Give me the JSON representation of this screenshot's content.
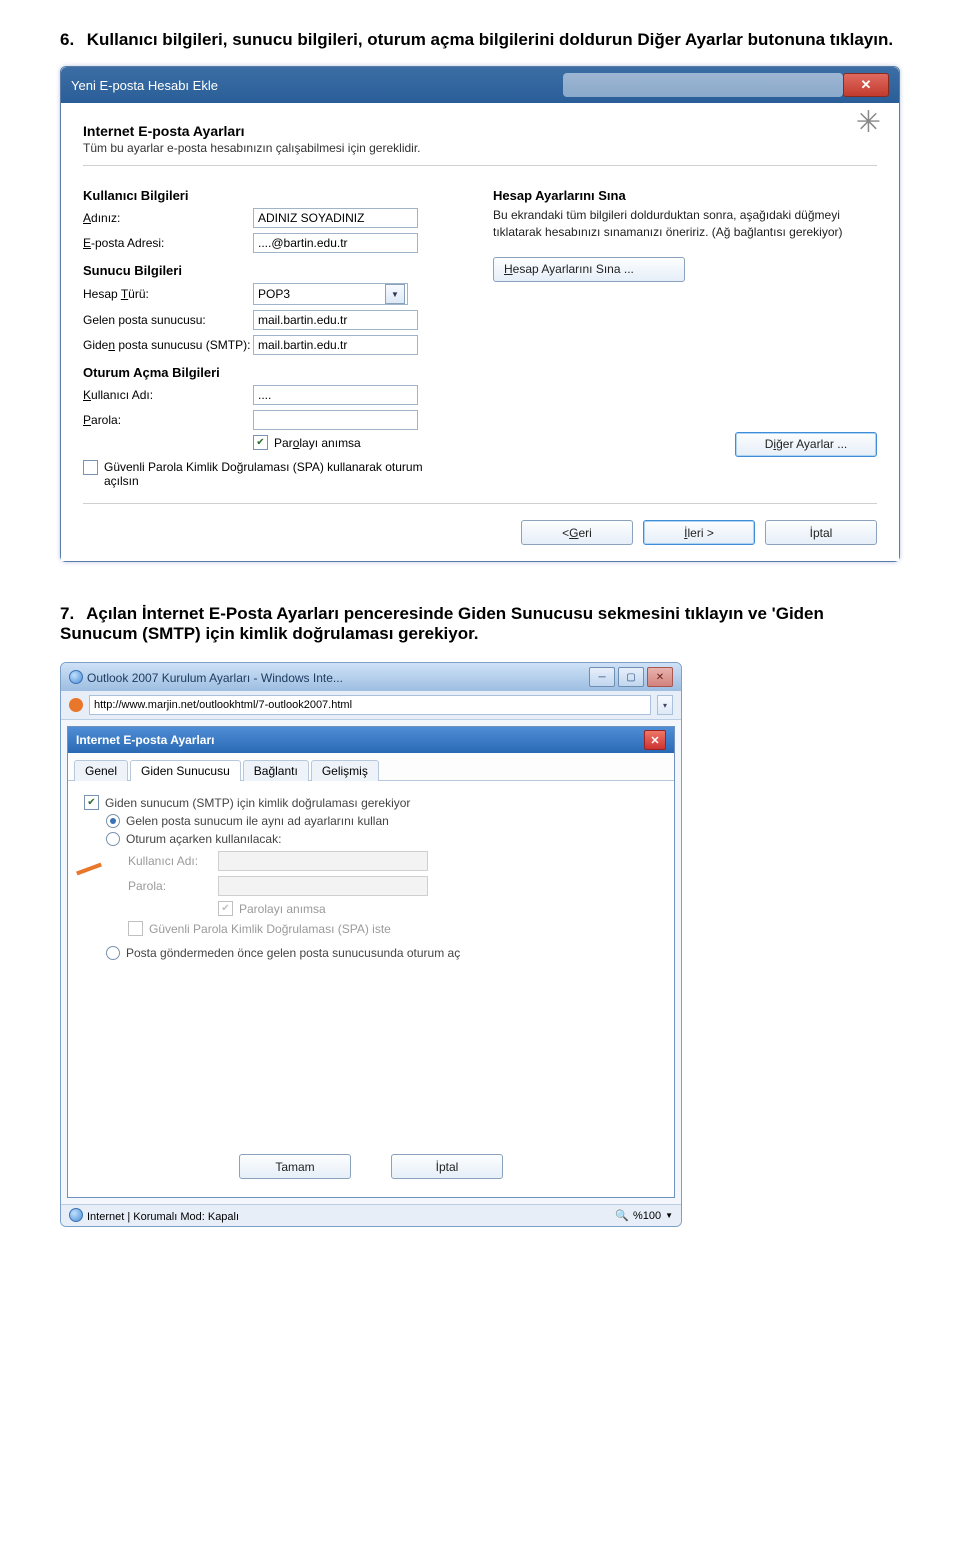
{
  "step6": {
    "num": "6.",
    "text": "Kullanıcı bilgileri, sunucu bilgileri, oturum açma bilgilerini doldurun Diğer Ayarlar butonuna tıklayın."
  },
  "win1": {
    "title": "Yeni E-posta Hesabı Ekle",
    "header_title": "Internet E-posta Ayarları",
    "header_sub": "Tüm bu ayarlar e-posta hesabınızın çalışabilmesi için gereklidir.",
    "left": {
      "user_heading": "Kullanıcı Bilgileri",
      "name_label_a": "A",
      "name_label_b": "dınız:",
      "name_val": "ADINIZ SOYADINIZ",
      "email_label_a": "E",
      "email_label_b": "-posta Adresi:",
      "email_val": "....@bartin.edu.tr",
      "server_heading": "Sunucu Bilgileri",
      "type_label_a": "Hesap ",
      "type_label_u": "T",
      "type_label_b": "ürü:",
      "type_val": "POP3",
      "incoming_label": "Gelen posta sunucusu:",
      "incoming_val": "mail.bartin.edu.tr",
      "outgoing_label_a": "Gide",
      "outgoing_label_u": "n",
      "outgoing_label_b": " posta sunucusu (SMTP):",
      "outgoing_val": "mail.bartin.edu.tr",
      "login_heading": "Oturum Açma Bilgileri",
      "user_label_a": "K",
      "user_label_b": "ullanıcı Adı:",
      "user_val": "....",
      "pass_label_a": "P",
      "pass_label_b": "arola:",
      "pass_val": "",
      "remember_a": "Par",
      "remember_u": "o",
      "remember_b": "layı anımsa",
      "spa": "Güvenli Parola Kimlik Doğrulaması (SPA) kullanarak oturum açılsın"
    },
    "right": {
      "heading": "Hesap Ayarlarını Sına",
      "desc": "Bu ekrandaki tüm bilgileri doldurduktan sonra, aşağıdaki düğmeyi tıklatarak hesabınızı sınamanızı öneririz. (Ağ bağlantısı gerekiyor)",
      "test_btn_a": "H",
      "test_btn_b": "esap Ayarlarını Sına ...",
      "more_btn_a": "D",
      "more_btn_u": "i",
      "more_btn_b": "ğer Ayarlar ..."
    },
    "footer": {
      "back_a": "< ",
      "back_u": "G",
      "back_b": "eri",
      "next_u": "İ",
      "next_b": "leri >",
      "cancel": "İptal"
    }
  },
  "step7": {
    "num": "7.",
    "text": "Açılan İnternet E-Posta Ayarları penceresinde Giden Sunucusu sekmesini tıklayın ve 'Giden Sunucum (SMTP) için kimlik doğrulaması gerekiyor."
  },
  "win2": {
    "ie_title": "Outlook 2007 Kurulum Ayarları - Windows Inte...",
    "url": "http://www.marjin.net/outlookhtml/7-outlook2007.html",
    "inner_title": "Internet E-posta Ayarları",
    "tabs": {
      "general": "Genel",
      "outgoing": "Giden Sunucusu",
      "conn": "Bağlantı",
      "adv": "Gelişmiş"
    },
    "chk_main": "Giden sunucum (SMTP) için kimlik doğrulaması gerekiyor",
    "opt1": "Gelen posta sunucum ile aynı ad ayarlarını kullan",
    "opt2": "Oturum açarken kullanılacak:",
    "user_label": "Kullanıcı Adı:",
    "pass_label": "Parola:",
    "remember": "Parolayı anımsa",
    "spa_short": "Güvenli Parola Kimlik Doğrulaması (SPA) iste",
    "opt3": "Posta göndermeden önce gelen posta sunucusunda oturum aç",
    "ok": "Tamam",
    "cancel": "İptal",
    "status_left": "Internet | Korumalı Mod: Kapalı",
    "zoom": "%100"
  }
}
